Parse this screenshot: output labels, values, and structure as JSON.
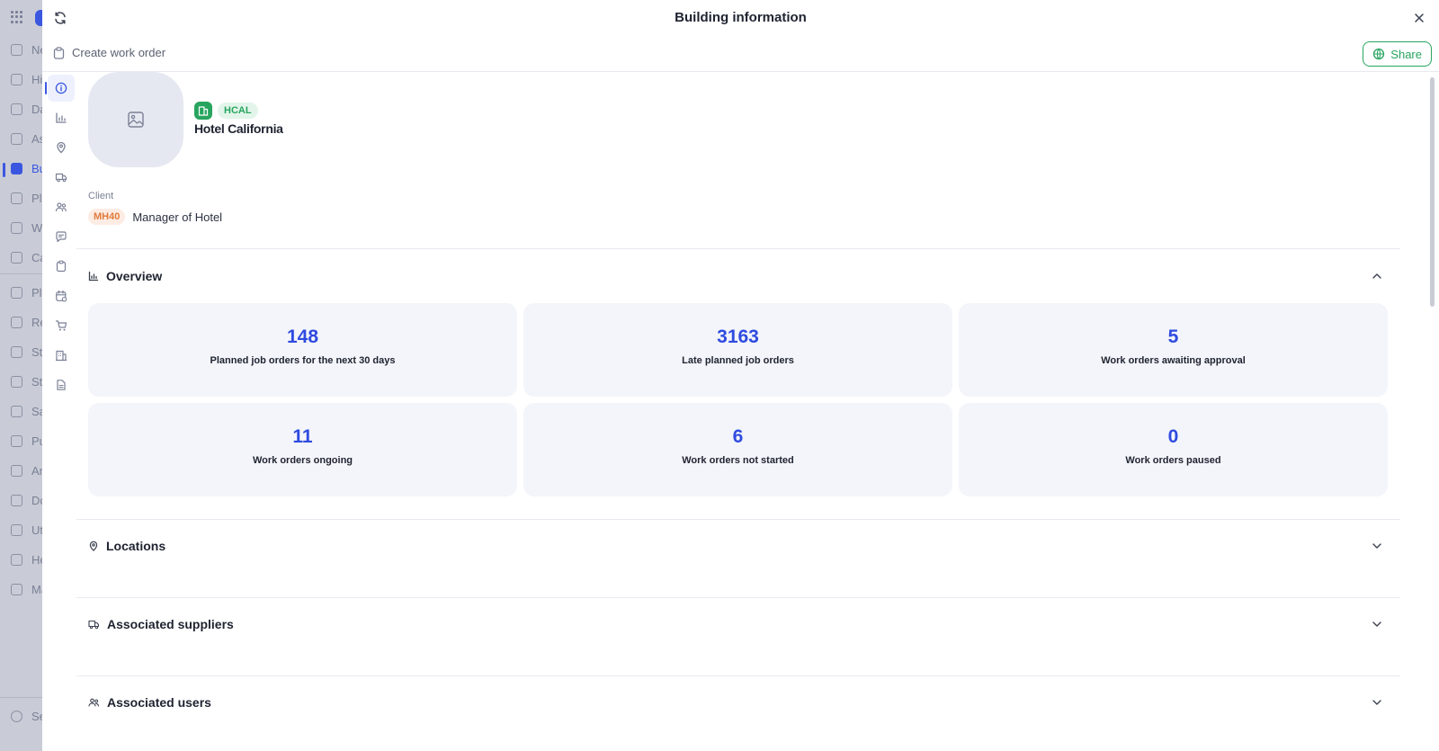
{
  "background_app": {
    "sidebar_items": [
      {
        "label": "Ne",
        "icon": "globe-icon"
      },
      {
        "label": "Hi",
        "icon": "clock-icon"
      },
      {
        "label": "Da",
        "icon": "dashboard-icon"
      },
      {
        "label": "As",
        "icon": "tools-icon"
      },
      {
        "label": "Bu",
        "icon": "building-icon"
      },
      {
        "label": "Pl",
        "icon": "calendar-icon"
      },
      {
        "label": "W",
        "icon": "clipboard-icon"
      },
      {
        "label": "Ca",
        "icon": "calendar-icon"
      },
      {
        "label": "Pl",
        "icon": "calendar-icon"
      },
      {
        "label": "Re",
        "icon": "bell-icon"
      },
      {
        "label": "St",
        "icon": "users-icon"
      },
      {
        "label": "St",
        "icon": "users-icon"
      },
      {
        "label": "Sa",
        "icon": "tag-icon"
      },
      {
        "label": "Pu",
        "icon": "cart-icon"
      },
      {
        "label": "An",
        "icon": "chart-icon"
      },
      {
        "label": "Do",
        "icon": "document-icon"
      },
      {
        "label": "Ut",
        "icon": "bolt-icon"
      },
      {
        "label": "He",
        "icon": "home-icon"
      },
      {
        "label": "Ma",
        "icon": "pin-icon"
      }
    ],
    "settings_label": "Se"
  },
  "modal": {
    "title": "Building information",
    "create_work_order": "Create work order",
    "share": "Share"
  },
  "rail_icons": [
    "info-icon",
    "chart-icon",
    "location-icon",
    "truck-icon",
    "users-icon",
    "message-icon",
    "clipboard-icon",
    "calendar-check-icon",
    "cart-icon",
    "building-icon",
    "document-icon"
  ],
  "building": {
    "code": "HCAL",
    "name": "Hotel California"
  },
  "client": {
    "label": "Client",
    "code": "MH40",
    "name": "Manager of Hotel"
  },
  "sections": {
    "overview": "Overview",
    "locations": "Locations",
    "suppliers": "Associated suppliers",
    "users": "Associated users"
  },
  "stats": [
    {
      "value": "148",
      "caption": "Planned job orders for the next 30 days"
    },
    {
      "value": "3163",
      "caption": "Late planned job orders"
    },
    {
      "value": "5",
      "caption": "Work orders awaiting approval"
    },
    {
      "value": "11",
      "caption": "Work orders ongoing"
    },
    {
      "value": "6",
      "caption": "Work orders not started"
    },
    {
      "value": "0",
      "caption": "Work orders paused"
    }
  ],
  "colors": {
    "accent": "#2f4be0",
    "success": "#27a55f",
    "client_tag": "#e07a3b"
  }
}
